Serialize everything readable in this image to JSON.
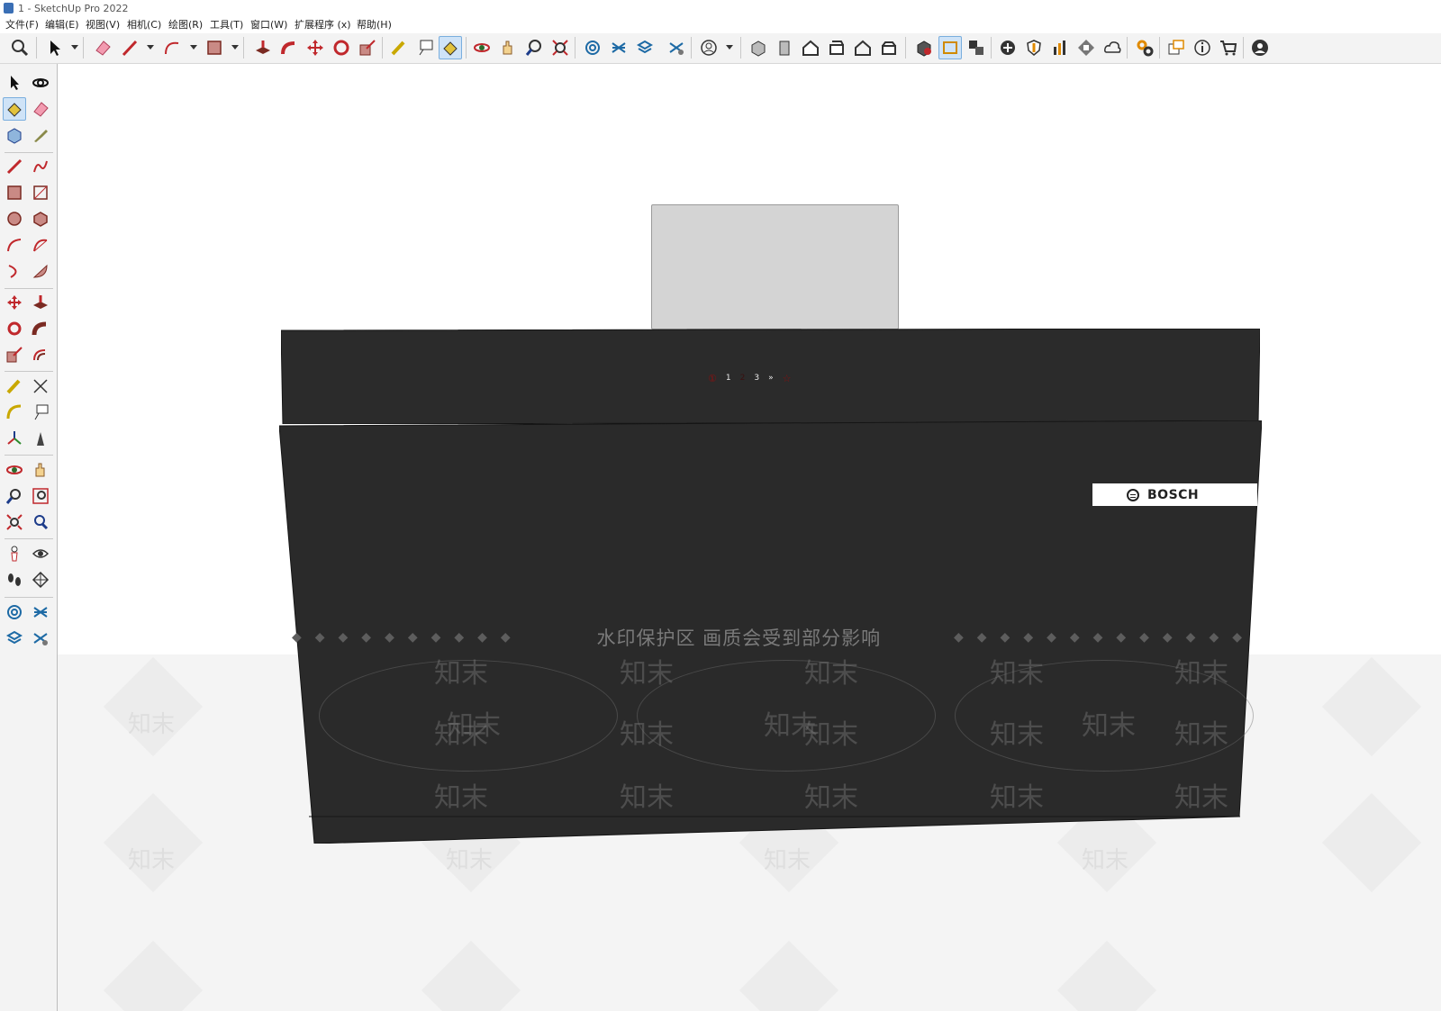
{
  "window": {
    "title": "1 - SketchUp Pro 2022"
  },
  "menu": [
    {
      "label": "文件(F)"
    },
    {
      "label": "编辑(E)"
    },
    {
      "label": "视图(V)"
    },
    {
      "label": "相机(C)"
    },
    {
      "label": "绘图(R)"
    },
    {
      "label": "工具(T)"
    },
    {
      "label": "窗口(W)"
    },
    {
      "label": "扩展程序 (x)"
    },
    {
      "label": "帮助(H)"
    }
  ],
  "toolbar": {
    "icons": [
      "zoom-icon",
      "select-icon",
      "eraser-icon",
      "line-icon",
      "arc-icon",
      "rectangle-icon",
      "push-pull-icon",
      "follow-me-icon",
      "move-icon",
      "rotate-icon",
      "scale-icon",
      "tape-measure-icon",
      "text-icon",
      "paint-bucket-icon",
      "orbit-icon",
      "pan-icon",
      "zoom-tool-icon",
      "zoom-extents-icon",
      "warehouse-icon",
      "extension-warehouse-icon",
      "layout-icon",
      "extension-manager-icon",
      "user-icon",
      "iso-view-icon",
      "front-view-icon",
      "top-view-icon",
      "right-view-icon",
      "back-view-icon",
      "left-view-icon",
      "solid-tools-icon",
      "section-icon",
      "component-icon",
      "add-icon",
      "shield-icon",
      "chart-icon",
      "checker-icon",
      "cloud-icon",
      "settings-icon",
      "window-icon",
      "info-icon",
      "cart-icon",
      "account-icon"
    ],
    "active": "paint-bucket-icon"
  },
  "sidebar": {
    "icons": [
      "select-icon",
      "orbit-icon",
      "paint-bucket-icon",
      "eraser-icon",
      "component-icon",
      "tag-icon",
      "line-icon",
      "freehand-icon",
      "rectangle-icon",
      "rotated-rectangle-icon",
      "circle-icon",
      "polygon-icon",
      "arc-icon",
      "two-point-arc-icon",
      "three-point-arc-icon",
      "pie-icon",
      "move-icon",
      "push-pull-icon",
      "rotate-icon",
      "follow-me-icon",
      "scale-icon",
      "offset-icon",
      "tape-measure-icon",
      "dimension-icon",
      "protractor-icon",
      "text-icon",
      "axes-icon",
      "3d-text-icon",
      "orbit-tool-icon",
      "pan-icon",
      "zoom-icon",
      "zoom-window-icon",
      "zoom-extents-icon",
      "previous-view-icon",
      "position-camera-icon",
      "look-around-icon",
      "walk-icon",
      "section-plane-icon",
      "warehouse-icon",
      "extension-warehouse-icon",
      "layout-icon",
      "extension-manager-icon"
    ],
    "active": "paint-bucket-icon"
  },
  "model": {
    "brand": "BOSCH",
    "controls": [
      "①",
      "1",
      "2",
      "3",
      "»",
      "☆"
    ]
  },
  "watermark": {
    "band_text": "水印保护区   画质会受到部分影响",
    "mark": "知末"
  },
  "colors": {
    "hood": "#2a2a2a",
    "duct": "#d4d4d4",
    "accent_active": "#cfe3f7",
    "control_off": "#8b1010"
  }
}
